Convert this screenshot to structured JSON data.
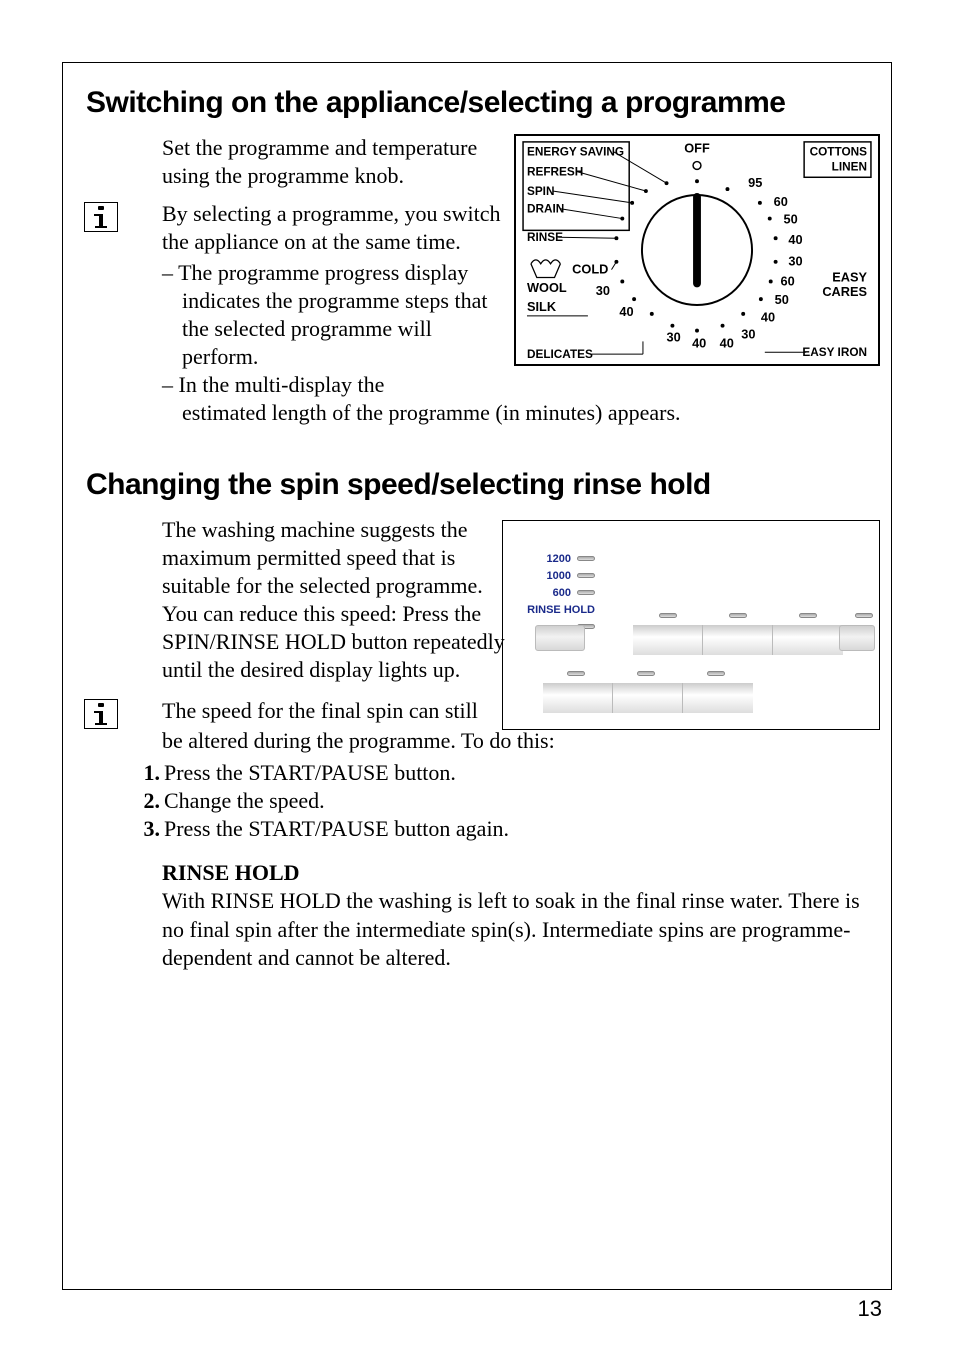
{
  "page_number": "13",
  "section1": {
    "title": "Switching on the appliance/selecting a programme",
    "intro": "Set the programme and temperature using the programme knob.",
    "info_lead": "By selecting a programme, you switch the appliance on at the same time.",
    "bullet1_narrow": "The programme progress display indicates the programme steps that the selected programme will perform.",
    "bullet2_line1": "In the multi-display the",
    "bullet2_line2": "estimated length of the programme (in minutes) appears."
  },
  "knob": {
    "top_left": [
      "ENERGY SAVING",
      "REFRESH",
      "SPIN",
      "DRAIN",
      "RINSE"
    ],
    "top_center": "OFF",
    "top_right": [
      "COTTONS",
      "LINEN"
    ],
    "right_temps": [
      "95",
      "60",
      "50",
      "40",
      "30"
    ],
    "right_labels": [
      "EASY",
      "CARES"
    ],
    "bottom_right_temps": [
      "60",
      "50",
      "40"
    ],
    "bottom_right_label": "EASY IRON",
    "left_bottom": [
      "COLD",
      "WOOL",
      "SILK"
    ],
    "left_30": "30",
    "left_40": "40",
    "bottom_temps_left": [
      "30",
      "40"
    ],
    "bottom_temps_right": [
      "40",
      "30"
    ],
    "bottom_label": "DELICATES"
  },
  "section2": {
    "title": "Changing the spin speed/selecting rinse hold",
    "intro": "The washing machine suggests the maximum permitted speed that is suitable for the selected programme. You can reduce this speed: Press the SPIN/RINSE HOLD button repeatedly until the desired display lights up.",
    "info_line1": "The speed for the final spin can still",
    "info_line2": "be altered during the programme. To do this:",
    "step1": "Press the START/PAUSE button.",
    "step2": "Change the speed.",
    "step3": "Press the START/PAUSE button again.",
    "rinse_hold_label": "RINSE HOLD",
    "rinse_hold_text": "With RINSE HOLD the washing is left to soak in the final rinse water. There is no final spin after the intermediate spin(s). Intermediate spins are programme-dependent and cannot be altered."
  },
  "spin_panel": {
    "speeds": [
      "1200",
      "1000",
      "600",
      "RINSE HOLD"
    ]
  }
}
